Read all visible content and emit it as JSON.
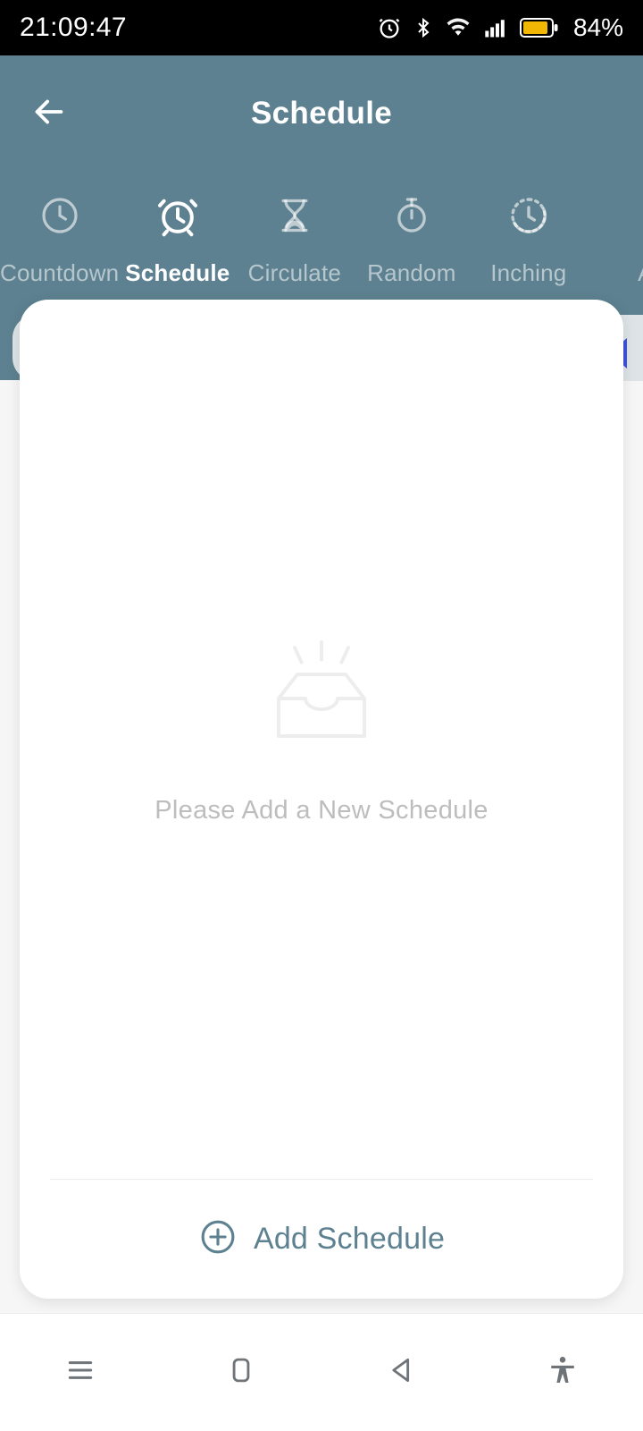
{
  "statusbar": {
    "time": "21:09:47",
    "battery_percent": "84%",
    "icons": [
      "alarm-icon",
      "bluetooth-icon",
      "wifi-icon",
      "cellular-signal-icon",
      "battery-icon"
    ]
  },
  "appbar": {
    "title": "Schedule",
    "back_icon": "arrow-left-icon"
  },
  "tabs": [
    {
      "label": "Countdown",
      "icon": "clock-icon",
      "active": false
    },
    {
      "label": "Schedule",
      "icon": "alarm-clock-icon",
      "active": true
    },
    {
      "label": "Circulate",
      "icon": "hourglass-icon",
      "active": false
    },
    {
      "label": "Random",
      "icon": "stopwatch-icon",
      "active": false
    },
    {
      "label": "Inching",
      "icon": "dashed-clock-icon",
      "active": false
    },
    {
      "label": "A",
      "icon": "partial-icon",
      "active": false
    }
  ],
  "card": {
    "empty_state": {
      "icon": "empty-tray-icon",
      "message": "Please Add a New Schedule"
    },
    "add_button": {
      "label": "Add Schedule",
      "icon": "plus-circle-icon"
    }
  },
  "swipe_marker": {
    "icon": "triangle-left-icon"
  },
  "navbar": {
    "buttons": [
      {
        "name": "recents-button",
        "icon": "menu-lines-icon"
      },
      {
        "name": "home-button",
        "icon": "rounded-square-icon"
      },
      {
        "name": "back-button",
        "icon": "triangle-left-icon"
      },
      {
        "name": "accessibility-button",
        "icon": "accessibility-person-icon"
      }
    ]
  },
  "colors": {
    "header": "#5d8190",
    "accent": "#5d8190",
    "marker": "#3f51d8",
    "battery": "#f2b705",
    "card": "#ffffff",
    "page_bg": "#f6f6f6",
    "muted_text": "#bdbdbd"
  }
}
